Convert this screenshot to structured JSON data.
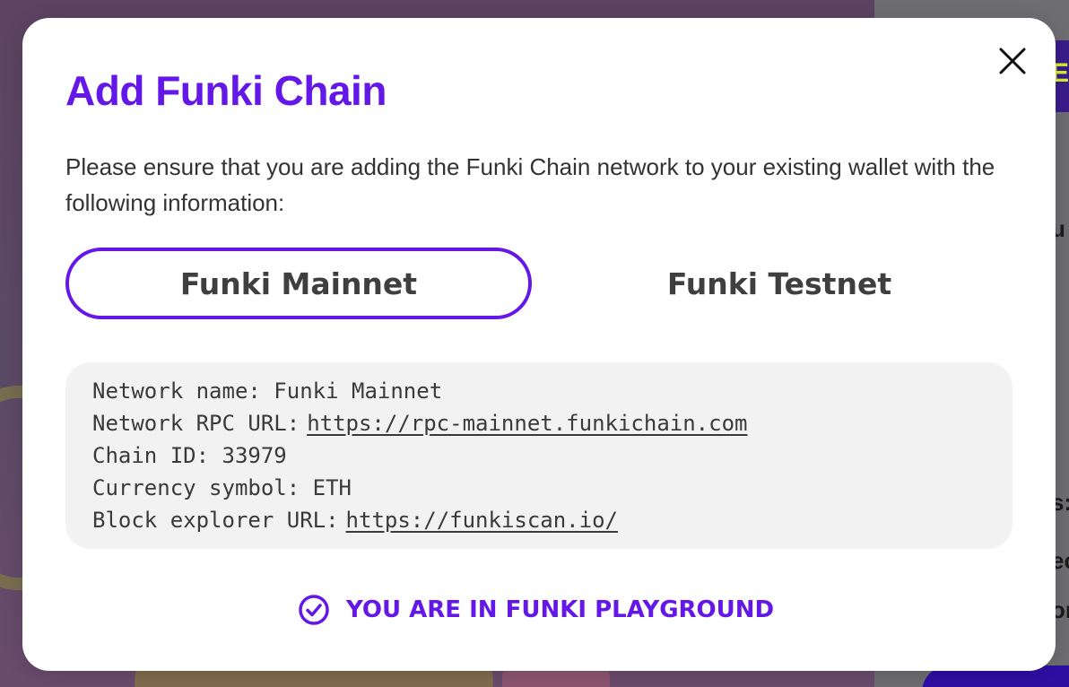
{
  "background": {
    "right_button_glyph": "E",
    "right_texts": [
      "u",
      "s:",
      "ec",
      "or"
    ]
  },
  "modal": {
    "title": "Add Funki Chain",
    "description": "Please ensure that you are adding the Funki Chain network to your existing wallet with the following information:",
    "close_icon": "close-icon",
    "tabs": [
      {
        "label": "Funki Mainnet",
        "active": true
      },
      {
        "label": "Funki Testnet",
        "active": false
      }
    ],
    "info": {
      "network_name_label": "Network name:",
      "network_name_value": "Funki Mainnet",
      "rpc_label": "Network RPC URL:",
      "rpc_value": "https://rpc-mainnet.funkichain.com",
      "chain_id_label": "Chain ID:",
      "chain_id_value": "33979",
      "currency_label": "Currency symbol:",
      "currency_value": "ETH",
      "explorer_label": "Block explorer URL:",
      "explorer_value": "https://funkiscan.io/"
    },
    "status": {
      "icon": "check-circle-icon",
      "text": "YOU ARE IN FUNKI PLAYGROUND"
    }
  },
  "colors": {
    "accent": "#6418e8",
    "info_bg": "#f2f2f2",
    "text": "#333333"
  }
}
